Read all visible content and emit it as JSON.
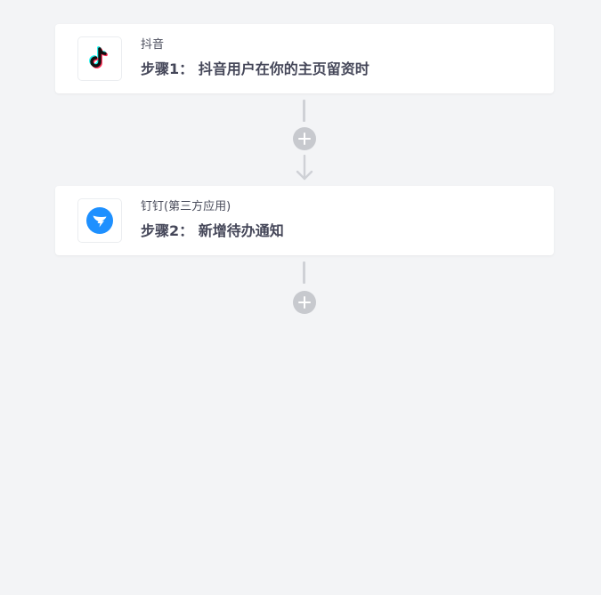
{
  "workflow": {
    "steps": [
      {
        "app_name": "抖音",
        "title": "步骤1： 抖音用户在你的主页留资时",
        "icon": "tiktok-logo-icon"
      },
      {
        "app_name": "钉钉(第三方应用)",
        "title": "步骤2： 新增待办通知",
        "icon": "dingtalk-logo-icon"
      }
    ]
  },
  "colors": {
    "background": "#f3f4f6",
    "card": "#ffffff",
    "title_text": "#454759",
    "connector": "#cfd1d6",
    "add_button": "#c7c9ce",
    "dingtalk_blue": "#1e90ff"
  }
}
